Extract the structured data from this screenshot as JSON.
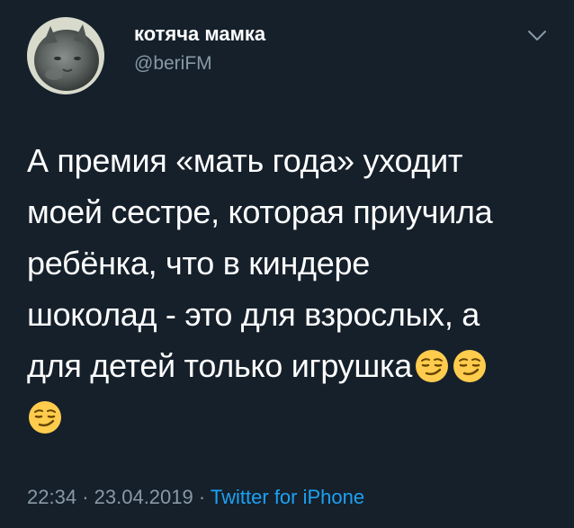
{
  "user": {
    "display_name": "котяча мамка",
    "handle": "@beriFM"
  },
  "tweet": {
    "lines": [
      "А премия «мать года» уходит",
      "моей сестре, которая приучила",
      "ребёнка, что в киндере",
      "шоколад - это для взрослых, а",
      "для детей только игрушка"
    ],
    "emoji": "smirking-face-emoji"
  },
  "meta": {
    "time": "22:34",
    "separator": "·",
    "date": "23.04.2019",
    "source": "Twitter for iPhone"
  },
  "colors": {
    "background": "#15202b",
    "text": "#ffffff",
    "secondary": "#8899a6",
    "link": "#1da1f2",
    "emoji_fill": "#ffcc4d"
  },
  "icons": {
    "menu": "chevron-down-icon"
  }
}
